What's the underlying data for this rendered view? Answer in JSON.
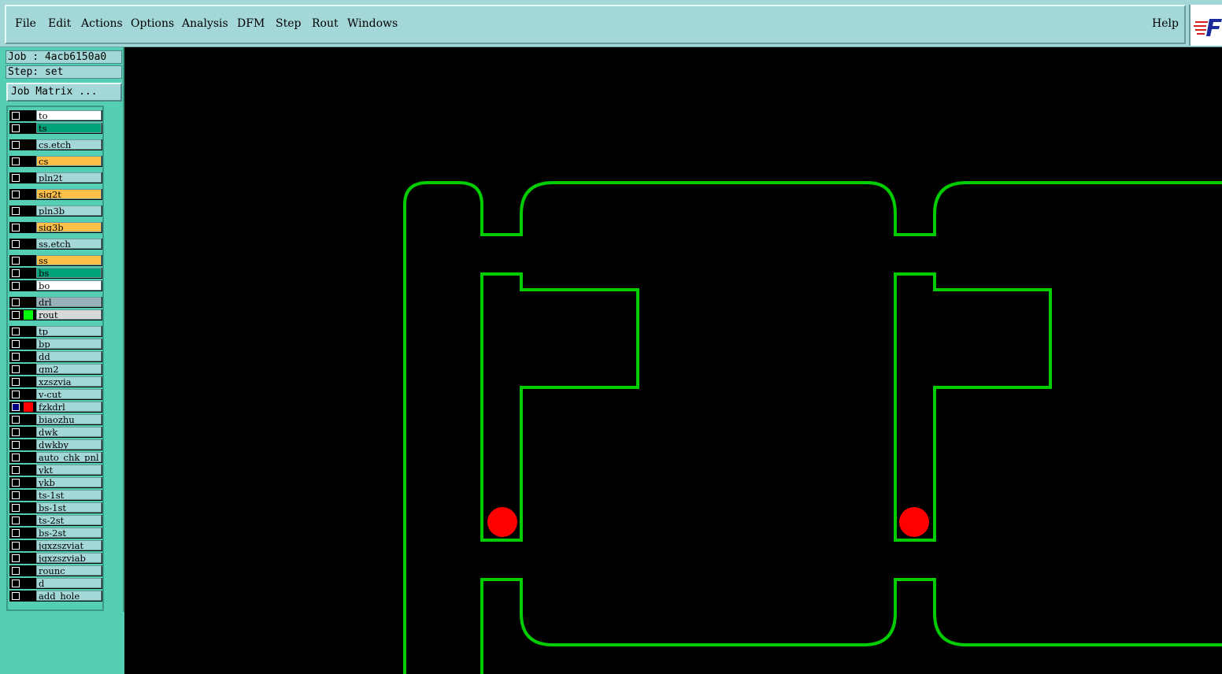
{
  "menubar": {
    "items": [
      "File",
      "Edit",
      "Actions",
      "Options",
      "Analysis",
      "DFM",
      "Step",
      "Rout",
      "Windows"
    ],
    "help": "Help"
  },
  "info": {
    "job": "Job : 4acb6150a0",
    "step": "Step: set",
    "job_matrix": "Job Matrix ..."
  },
  "layers": [
    {
      "name": "to",
      "color": "#ffffff"
    },
    {
      "name": "ts",
      "color": "#00a27a"
    },
    {
      "name": "cs.etch",
      "color": "#a4d8d8"
    },
    {
      "name": "cs",
      "color": "#ffc04a"
    },
    {
      "name": "pln2t",
      "color": "#a4d8d8"
    },
    {
      "name": "sig2t",
      "color": "#ffc04a"
    },
    {
      "name": "pln3b",
      "color": "#a4d8d8"
    },
    {
      "name": "sig3b",
      "color": "#ffc04a"
    },
    {
      "name": "ss.etch",
      "color": "#a4d8d8"
    },
    {
      "name": "ss",
      "color": "#ffc04a"
    },
    {
      "name": "bs",
      "color": "#00a27a"
    },
    {
      "name": "bo",
      "color": "#ffffff"
    },
    {
      "name": "drl",
      "color": "#9ab0b8"
    },
    {
      "name": "rout",
      "color": "#d8d8d8",
      "affected": "#00ff00"
    },
    {
      "name": "tp",
      "color": "#a4d8d8"
    },
    {
      "name": "bp",
      "color": "#a4d8d8"
    },
    {
      "name": "dd",
      "color": "#a4d8d8"
    },
    {
      "name": "gm2",
      "color": "#a4d8d8"
    },
    {
      "name": "xzszvia",
      "color": "#a4d8d8"
    },
    {
      "name": "v-cut",
      "color": "#a4d8d8"
    },
    {
      "name": "fzkdrl",
      "color": "#a4d8d8",
      "affected": "#ff0000",
      "selected": true
    },
    {
      "name": "biaozhu",
      "color": "#a4d8d8"
    },
    {
      "name": "dwk",
      "color": "#a4d8d8"
    },
    {
      "name": "dwkby",
      "color": "#a4d8d8"
    },
    {
      "name": "auto_chk_pnl",
      "color": "#a4d8d8"
    },
    {
      "name": "ykt",
      "color": "#a4d8d8"
    },
    {
      "name": "ykb",
      "color": "#a4d8d8"
    },
    {
      "name": "ts-1st",
      "color": "#a4d8d8"
    },
    {
      "name": "bs-1st",
      "color": "#a4d8d8"
    },
    {
      "name": "ts-2st",
      "color": "#a4d8d8"
    },
    {
      "name": "bs-2st",
      "color": "#a4d8d8"
    },
    {
      "name": "jgxzszviat",
      "color": "#a4d8d8"
    },
    {
      "name": "jgxzszviab",
      "color": "#a4d8d8"
    },
    {
      "name": "rounc",
      "color": "#a4d8d8"
    },
    {
      "name": "d",
      "color": "#a4d8d8"
    },
    {
      "name": "add_hole",
      "color": "#a4d8d8"
    }
  ],
  "canvas": {
    "background": "#000000",
    "rout_color": "#00cc00",
    "drill_color": "#ff0000"
  }
}
